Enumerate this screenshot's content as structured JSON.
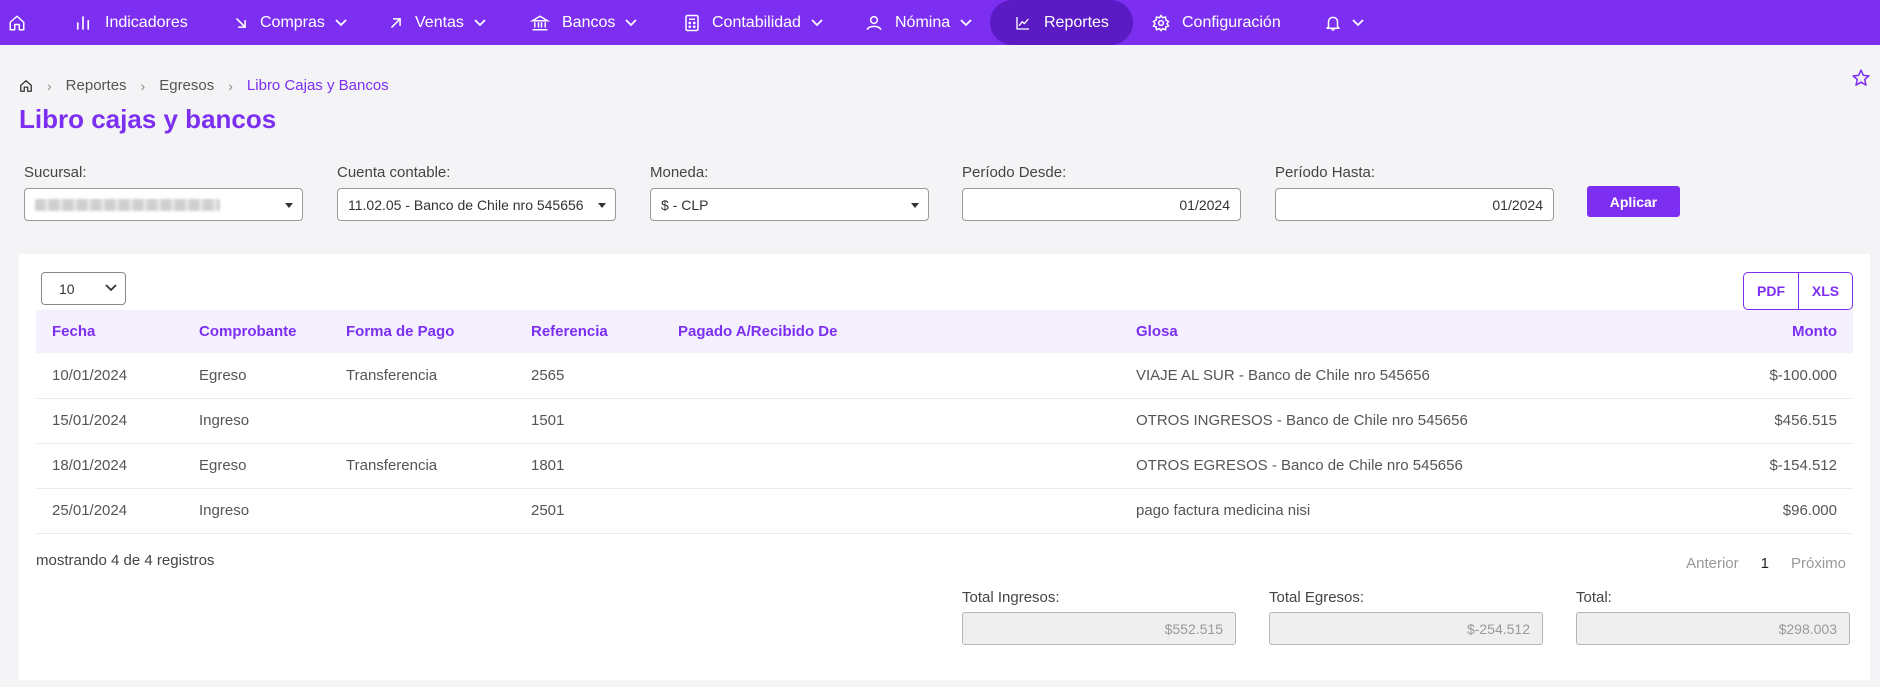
{
  "nav": {
    "items": [
      {
        "label": "Indicadores",
        "icon": "bar-chart-icon"
      },
      {
        "label": "Compras",
        "icon": "arrow-down-right-icon"
      },
      {
        "label": "Ventas",
        "icon": "arrow-up-right-icon"
      },
      {
        "label": "Bancos",
        "icon": "bank-icon"
      },
      {
        "label": "Contabilidad",
        "icon": "calculator-icon"
      },
      {
        "label": "Nómina",
        "icon": "user-icon"
      },
      {
        "label": "Reportes",
        "icon": "line-chart-icon"
      },
      {
        "label": "Configuración",
        "icon": "gear-icon"
      }
    ]
  },
  "breadcrumb": {
    "items": [
      "Reportes",
      "Egresos"
    ],
    "current": "Libro Cajas y Bancos"
  },
  "page_title": "Libro cajas y bancos",
  "filters": {
    "sucursal": {
      "label": "Sucursal:"
    },
    "cuenta": {
      "label": "Cuenta contable:",
      "value": "11.02.05 - Banco de Chile nro 545656"
    },
    "moneda": {
      "label": "Moneda:",
      "value": "$ - CLP"
    },
    "desde": {
      "label": "Período Desde:",
      "value": "01/2024"
    },
    "hasta": {
      "label": "Período Hasta:",
      "value": "01/2024"
    },
    "apply_label": "Aplicar"
  },
  "table": {
    "page_size": "10",
    "export": {
      "pdf": "PDF",
      "xls": "XLS"
    },
    "headers": [
      "Fecha",
      "Comprobante",
      "Forma de Pago",
      "Referencia",
      "Pagado A/Recibido De",
      "Glosa",
      "Monto"
    ],
    "rows": [
      [
        "10/01/2024",
        "Egreso",
        "Transferencia",
        "2565",
        "",
        "VIAJE AL SUR - Banco de Chile nro 545656",
        "$-100.000"
      ],
      [
        "15/01/2024",
        "Ingreso",
        "",
        "1501",
        "",
        "OTROS INGRESOS - Banco de Chile nro 545656",
        "$456.515"
      ],
      [
        "18/01/2024",
        "Egreso",
        "Transferencia",
        "1801",
        "",
        "OTROS EGRESOS - Banco de Chile nro 545656",
        "$-154.512"
      ],
      [
        "25/01/2024",
        "Ingreso",
        "",
        "2501",
        "",
        "pago factura medicina nisi",
        "$96.000"
      ]
    ],
    "showing": "mostrando 4 de 4 registros",
    "pager": {
      "prev": "Anterior",
      "current": "1",
      "next": "Próximo"
    }
  },
  "totals": {
    "ingresos": {
      "label": "Total Ingresos:",
      "value": "$552.515"
    },
    "egresos": {
      "label": "Total Egresos:",
      "value": "$-254.512"
    },
    "total": {
      "label": "Total:",
      "value": "$298.003"
    }
  },
  "colors": {
    "accent": "#7c2ff0",
    "nav_active": "#5a1bc4"
  }
}
